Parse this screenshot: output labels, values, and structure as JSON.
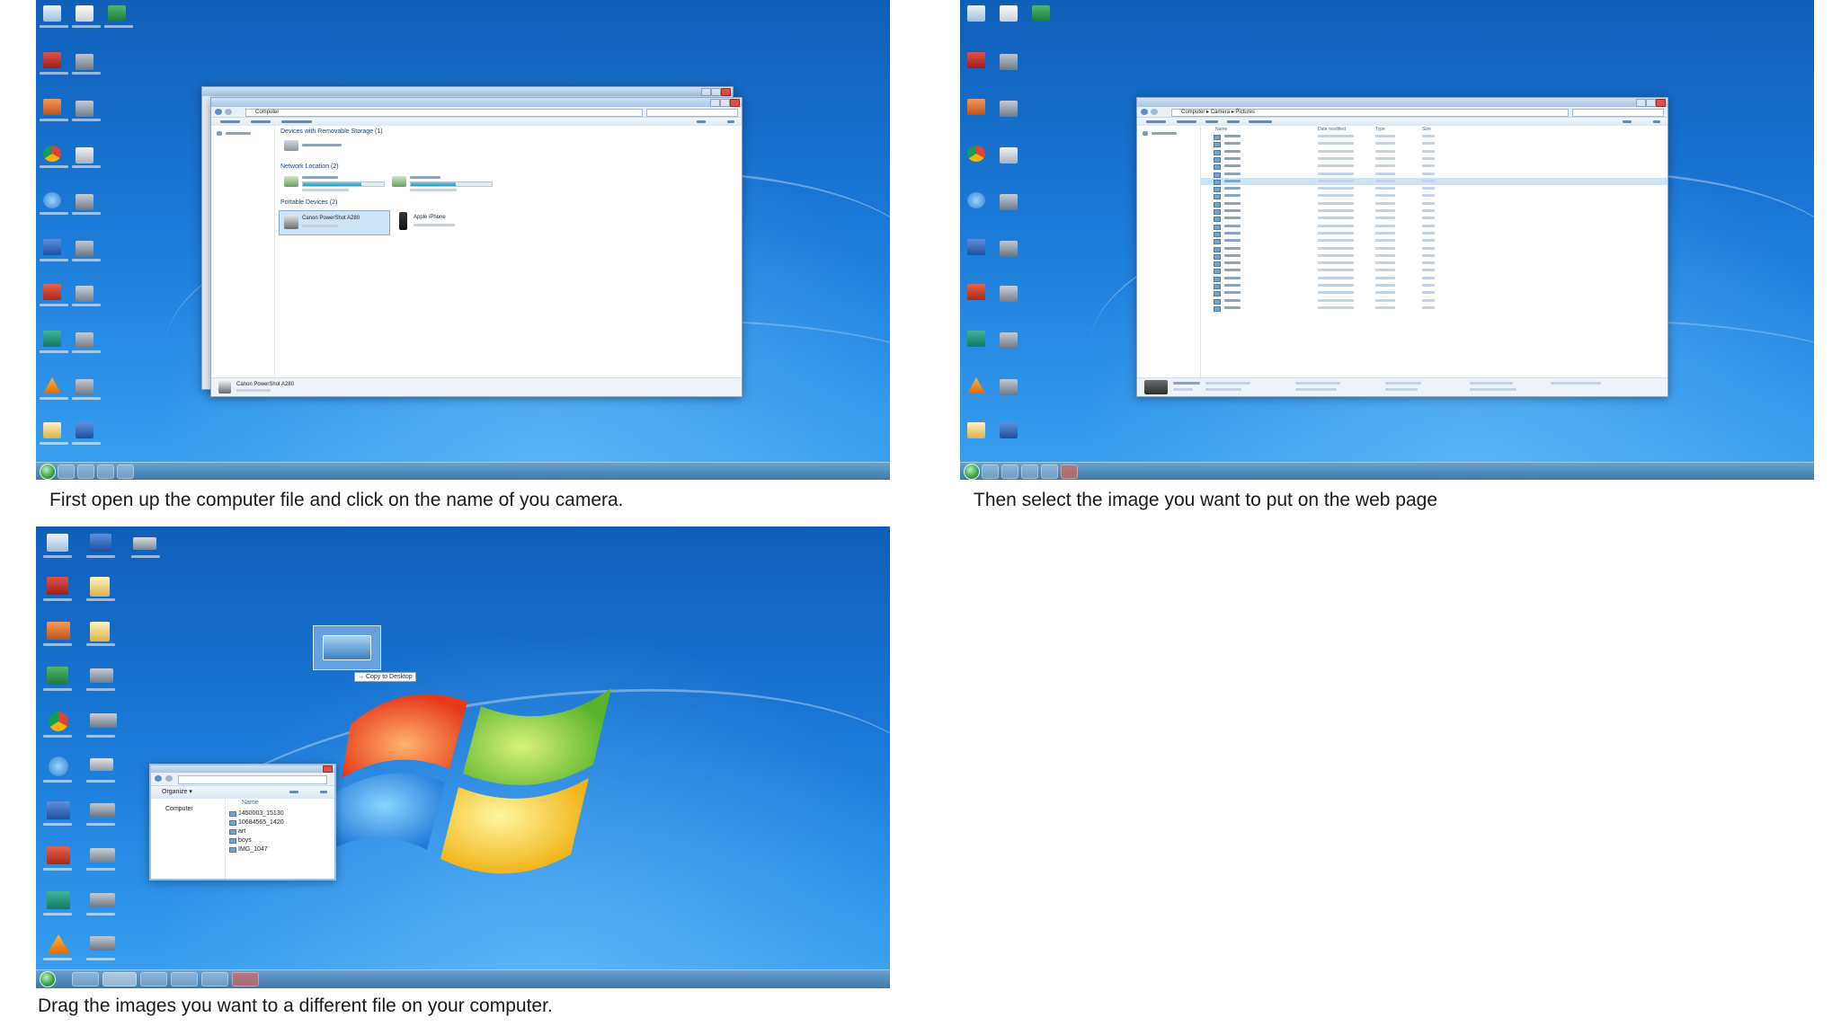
{
  "colors": {
    "desktop_blue": "#1a78d6",
    "taskbar": "#3c78aa",
    "window_bg": "#f4f7fb",
    "selection": "#cde4f7",
    "caption_text": "#1a1a1a"
  },
  "icons": [
    "recycle-bin-icon",
    "folder-icon",
    "excel-icon",
    "access-icon",
    "ie-icon",
    "chrome-icon",
    "word-icon",
    "powerpoint-icon",
    "publisher-icon",
    "vlc-icon",
    "picture-icon"
  ],
  "panels": [
    {
      "caption": "First open up the computer file and click on the name of you camera.",
      "window": "Computer",
      "groups": [
        "Devices with Removable Storage (1)",
        "Network Location (2)",
        "Portable Devices (2)"
      ],
      "devices": [
        "Canon PowerShot A280",
        "Apple iPhone"
      ],
      "status": "Canon PowerShot A280"
    },
    {
      "caption": "Then select the image you want to put on the web page",
      "window": "Computer ▸ Camera ▸ Pictures",
      "columns": [
        "Name",
        "Date modified",
        "Type",
        "Size"
      ],
      "selected_row": 6
    },
    {
      "caption": "Drag the images you want to a different file on your computer.",
      "drag_tip": "→ Copy to Desktop",
      "mini_window": {
        "organize": "Organize ▾",
        "nav_item": "Computer",
        "column": "Name",
        "files": [
          "1450003_15130",
          "10684565_1420",
          "art",
          "boys",
          "IMG_1047"
        ]
      }
    }
  ]
}
